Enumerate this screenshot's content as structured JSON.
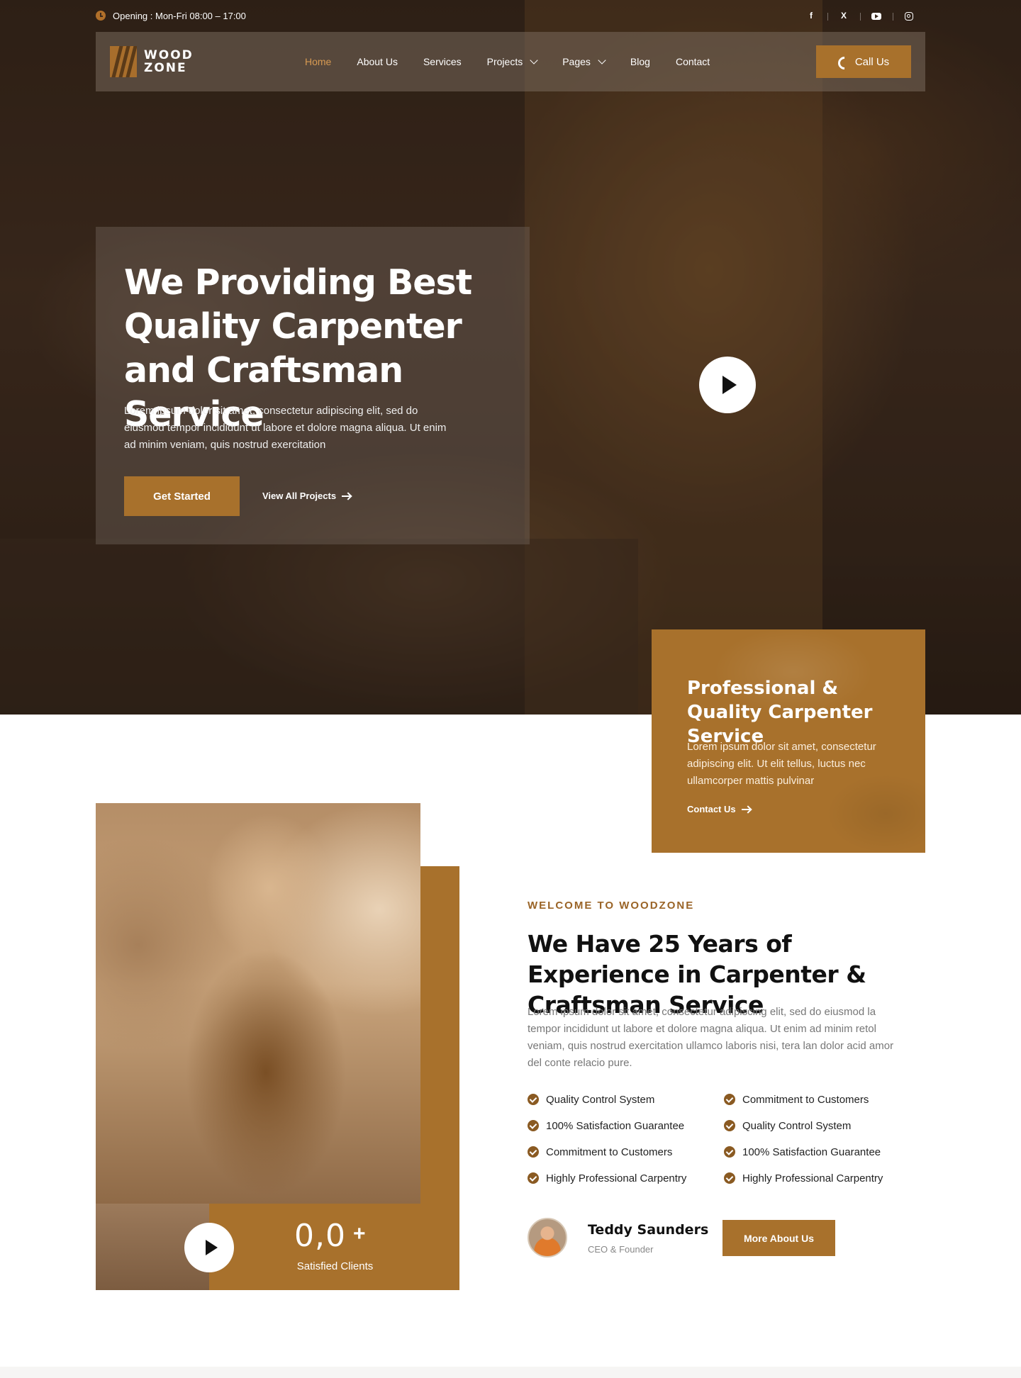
{
  "topbar": {
    "opening": "Opening : Mon-Fri 08:00 – 17:00",
    "socials": [
      {
        "icon": "facebook-icon",
        "glyph": "f"
      },
      {
        "icon": "x-icon",
        "glyph": "X"
      },
      {
        "icon": "youtube-icon",
        "glyph": ""
      },
      {
        "icon": "instagram-icon",
        "glyph": ""
      }
    ]
  },
  "header": {
    "logo_line1": "WOOD",
    "logo_line2": "ZONE",
    "nav": [
      {
        "label": "Home",
        "active": true
      },
      {
        "label": "About Us"
      },
      {
        "label": "Services"
      },
      {
        "label": "Projects",
        "dropdown": true
      },
      {
        "label": "Pages",
        "dropdown": true
      },
      {
        "label": "Blog"
      },
      {
        "label": "Contact"
      }
    ],
    "call_label": "Call Us"
  },
  "hero": {
    "title": "We Providing Best Quality Carpenter and Craftsman Service",
    "description": "Lorem ipsum dolor sit amet, consectetur adipiscing elit, sed do eiusmod tempor incididunt ut labore et dolore magna aliqua. Ut enim ad minim veniam, quis nostrud exercitation",
    "cta_primary": "Get Started",
    "cta_secondary": "View All Projects"
  },
  "service_card": {
    "title": "Professional & Quality Carpenter Service",
    "description": "Lorem ipsum dolor sit amet, consectetur adipiscing elit. Ut elit tellus, luctus nec ullamcorper mattis pulvinar",
    "link": "Contact Us"
  },
  "about": {
    "eyebrow": "WELCOME TO WOODZONE",
    "title": "We Have 25 Years of Experience in Carpenter & Craftsman Service",
    "description": "Lorem ipsum dolor sit amet, consectetur adipiscing elit, sed do eiusmod la tempor incididunt ut labore et dolore magna aliqua. Ut enim ad minim retol veniam, quis nostrud exercitation ullamco laboris nisi, tera lan dolor acid amor del conte relacio pure.",
    "features": [
      "Quality Control System",
      "Commitment to Customers",
      "100% Satisfaction Guarantee",
      "Quality Control System",
      "Commitment to Customers",
      "100% Satisfaction Guarantee",
      "Highly Professional Carpentry",
      "Highly Professional Carpentry"
    ],
    "stat_value": "0,0",
    "stat_suffix": "+",
    "stat_label": "Satisfied Clients",
    "founder_name": "Teddy Saunders",
    "founder_role": "CEO & Founder",
    "more_button": "More About Us"
  },
  "colors": {
    "accent": "#a8712c",
    "accent_dark": "#8a5a22",
    "nav_active": "#d79a52"
  }
}
